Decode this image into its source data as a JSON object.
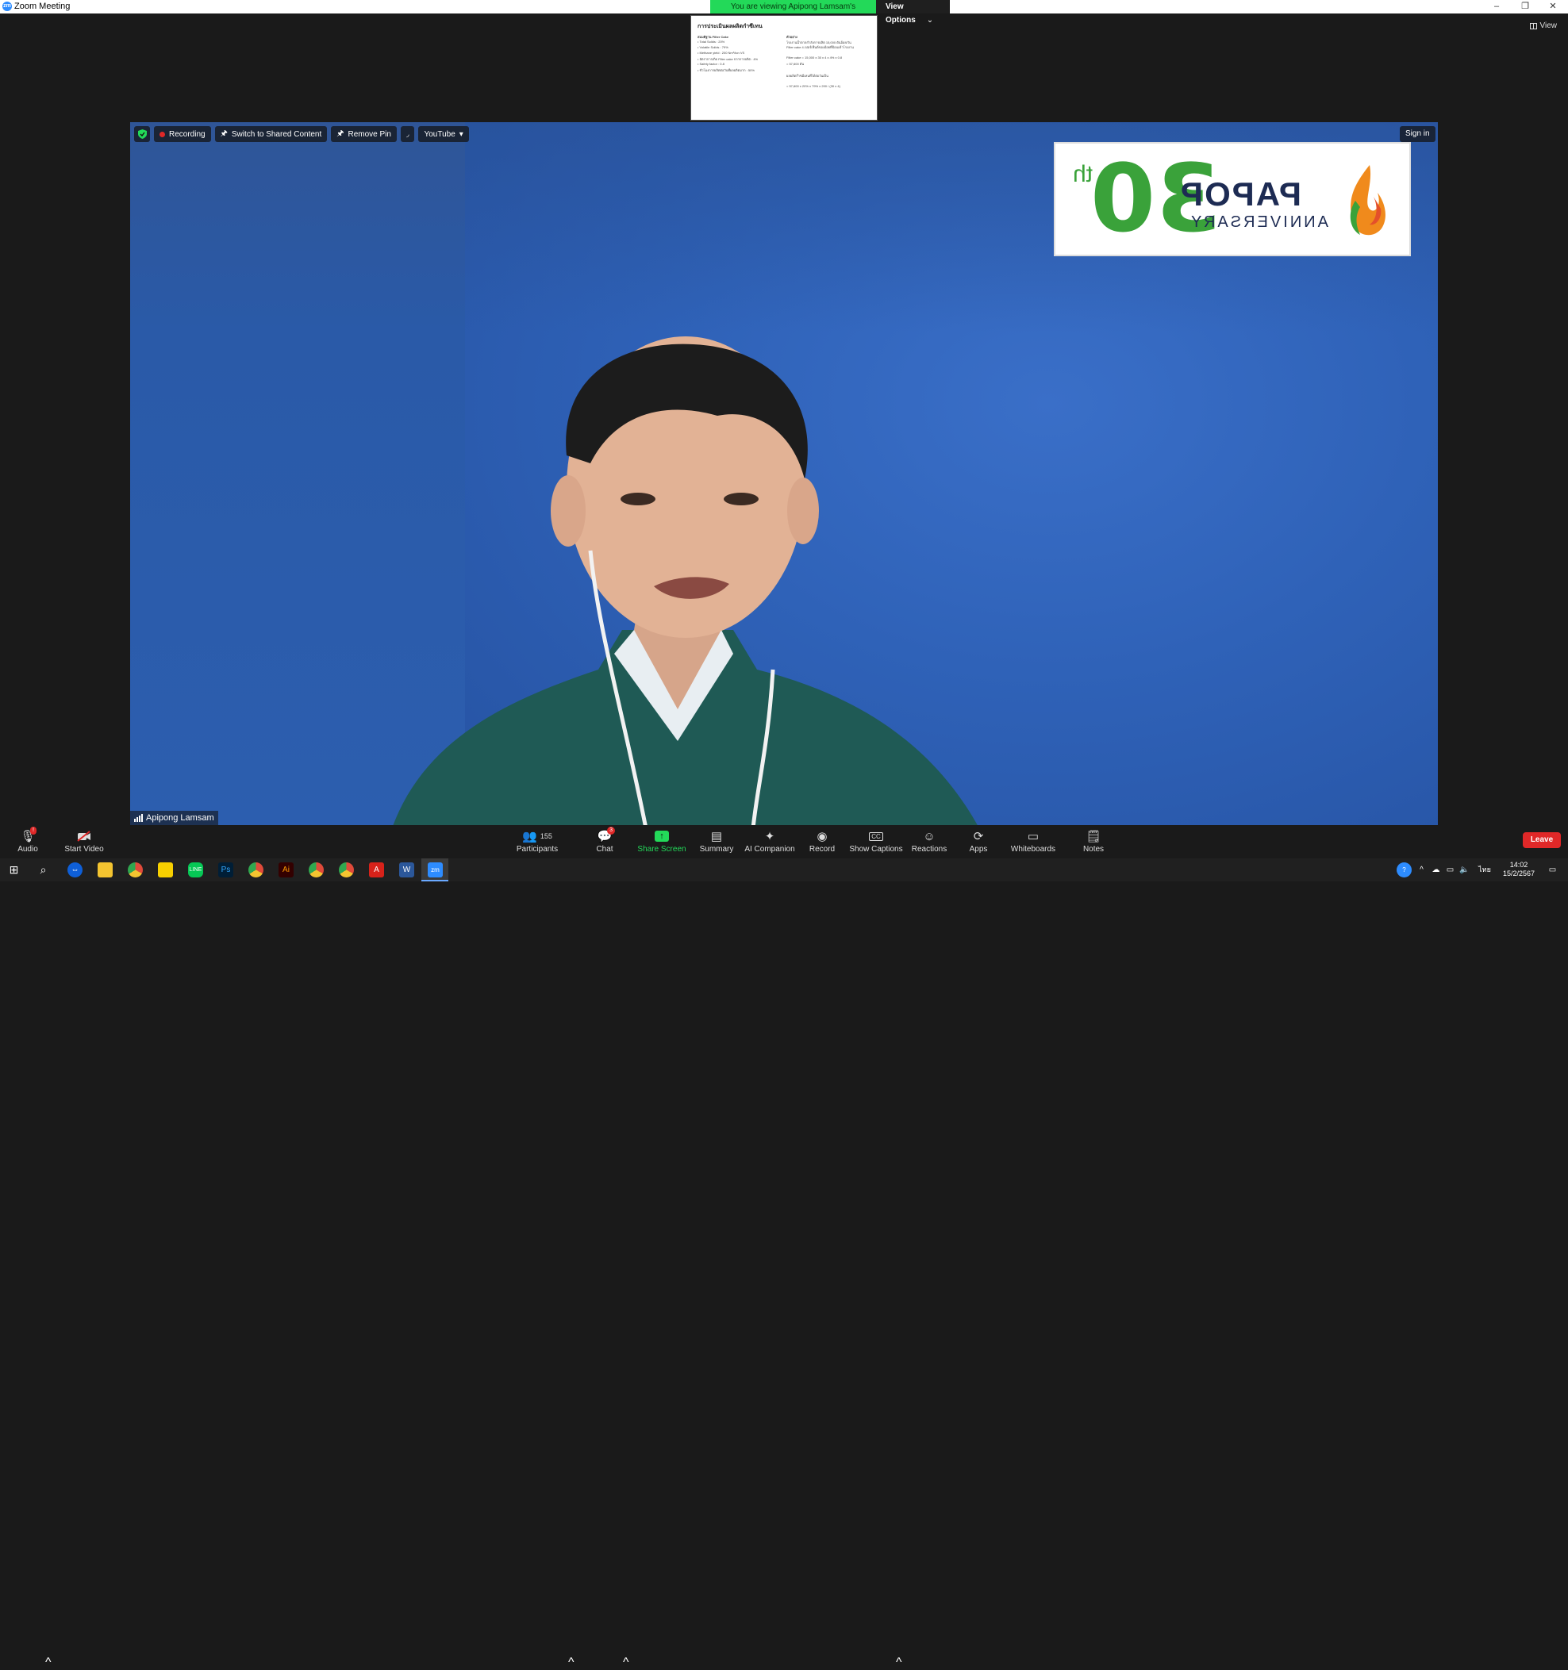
{
  "window": {
    "title": "Zoom Meeting",
    "app_icon": "zm",
    "minimize": "–",
    "restore": "❐",
    "close": "✕"
  },
  "banner": {
    "message": "You are viewing Apipong Lamsam's screen",
    "view_options": "View Options",
    "chevron": "⌄"
  },
  "view_button": {
    "label": "View"
  },
  "shared_thumbnail": {
    "title": "การประเมินผลผลิตกำซีเทน",
    "left_col_heading": "สมมติฐาน Filter Cake",
    "left_lines": [
      "• Total Solids : 20%",
      "• Volatile Solids : 79%",
      "• Methane yield : 200 Nm³/ton VS",
      "• อัตราการเกิด Filter cake จากการผลิต : 4%",
      "• Safety factor : 0.8",
      "• ชั่วโมงการผลิตต่อวันที่ผลผลิตมาก : 50%"
    ],
    "right_col_heading": "ตัวอย่าง",
    "right_lines": [
      "โรงงานน้ำตาลกำลังการผลิต 15,000 ตันอ้อย/วัน",
      "Filter cake 4 เปอร์เซ็นต์ของอ้อยที่ป้อนเข้าโรงงาน",
      "Filter cake = 15,000 x 30 x 4 x 4% x 0.8",
      "= 57,600 ตัน",
      "ผลผลิตก๊าซมีเทนที่ได้ต่อวันเป็น",
      "= 57,600 x 20% x 79% x 200 / (30 x 4)"
    ]
  },
  "top_controls": {
    "recording": "Recording",
    "switch_shared": "Switch to Shared Content",
    "remove_pin": "Remove Pin",
    "youtube": "YouTube",
    "youtube_caret": "▾",
    "sign_in": "Sign in"
  },
  "video": {
    "participant_name": "Apipong Lamsam",
    "logo": {
      "number": "30",
      "suffix": "th",
      "brand": "PAPOP",
      "sub": "ANNIVERSARY"
    }
  },
  "toolbar": {
    "audio": {
      "label": "Audio",
      "icon": "microphone-icon",
      "badge": "!"
    },
    "video": {
      "label": "Start Video",
      "icon": "video-off-icon"
    },
    "participants": {
      "label": "Participants",
      "count": "155"
    },
    "chat": {
      "label": "Chat",
      "badge": "3"
    },
    "share": {
      "label": "Share Screen"
    },
    "summary": {
      "label": "Summary"
    },
    "companion": {
      "label": "AI Companion"
    },
    "record": {
      "label": "Record"
    },
    "captions": {
      "label": "Show Captions",
      "cc": "CC"
    },
    "reactions": {
      "label": "Reactions"
    },
    "apps": {
      "label": "Apps"
    },
    "whiteboards": {
      "label": "Whiteboards"
    },
    "notes": {
      "label": "Notes"
    },
    "leave": "Leave",
    "caret": "^"
  },
  "taskbar": {
    "clock_time": "14:02",
    "clock_date": "15/2/2567",
    "lang": "ไทย",
    "apps": [
      "start-icon",
      "search-icon",
      "teamviewer-icon",
      "file-explorer-icon",
      "chrome-icon",
      "sticky-notes-icon",
      "line-icon",
      "photoshop-icon",
      "chrome-icon",
      "illustrator-icon",
      "chrome-icon",
      "chrome-icon",
      "acrobat-icon",
      "word-icon",
      "zoom-icon"
    ]
  },
  "colors": {
    "accent_green": "#23d959",
    "leave_red": "#e02828",
    "zoom_blue": "#2d8cff",
    "backdrop_blue": "#2f63b7"
  }
}
